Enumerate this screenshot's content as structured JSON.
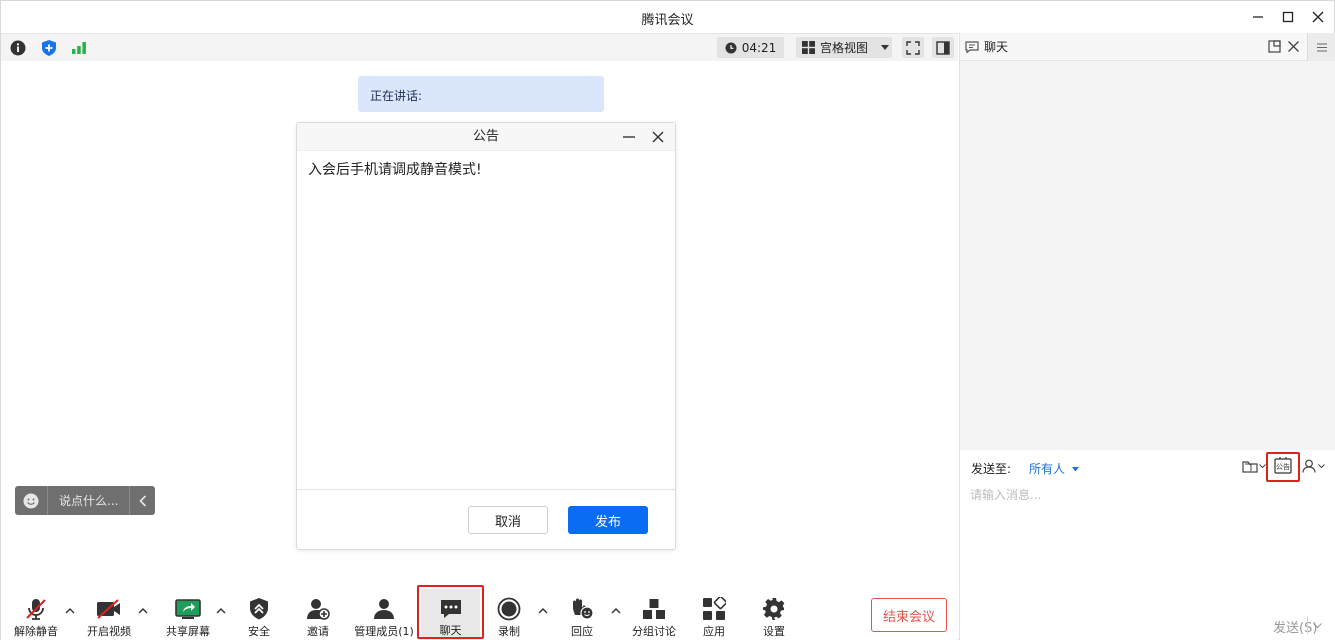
{
  "window": {
    "title": "腾讯会议"
  },
  "topbar": {
    "timer": "04:21",
    "view_label": "宫格视图"
  },
  "main": {
    "speaking_label": "正在讲话:",
    "dialog": {
      "title": "公告",
      "content": "入会后手机请调成静音模式!",
      "cancel_label": "取消",
      "publish_label": "发布"
    },
    "say_placeholder": "说点什么..."
  },
  "toolbar": {
    "items": [
      {
        "label": "解除静音",
        "icon": "mic-muted-icon"
      },
      {
        "label": "开启视频",
        "icon": "video-off-icon"
      },
      {
        "label": "共享屏幕",
        "icon": "share-screen-icon"
      },
      {
        "label": "安全",
        "icon": "shield-icon"
      },
      {
        "label": "邀请",
        "icon": "invite-icon"
      },
      {
        "label": "管理成员(1)",
        "icon": "members-icon"
      },
      {
        "label": "聊天",
        "icon": "chat-icon"
      },
      {
        "label": "录制",
        "icon": "record-icon"
      },
      {
        "label": "回应",
        "icon": "reaction-icon"
      },
      {
        "label": "分组讨论",
        "icon": "breakout-icon"
      },
      {
        "label": "应用",
        "icon": "apps-icon"
      },
      {
        "label": "设置",
        "icon": "gear-icon"
      }
    ],
    "end_label": "结束会议"
  },
  "chat": {
    "title": "聊天",
    "send_to_label": "发送至:",
    "send_to_value": "所有人",
    "input_placeholder": "请输入消息...",
    "announce_icon_text": "公告",
    "send_label": "发送(S)"
  },
  "colors": {
    "accent": "#0a6cf2",
    "danger": "#e5534b",
    "highlight": "#e12020"
  }
}
